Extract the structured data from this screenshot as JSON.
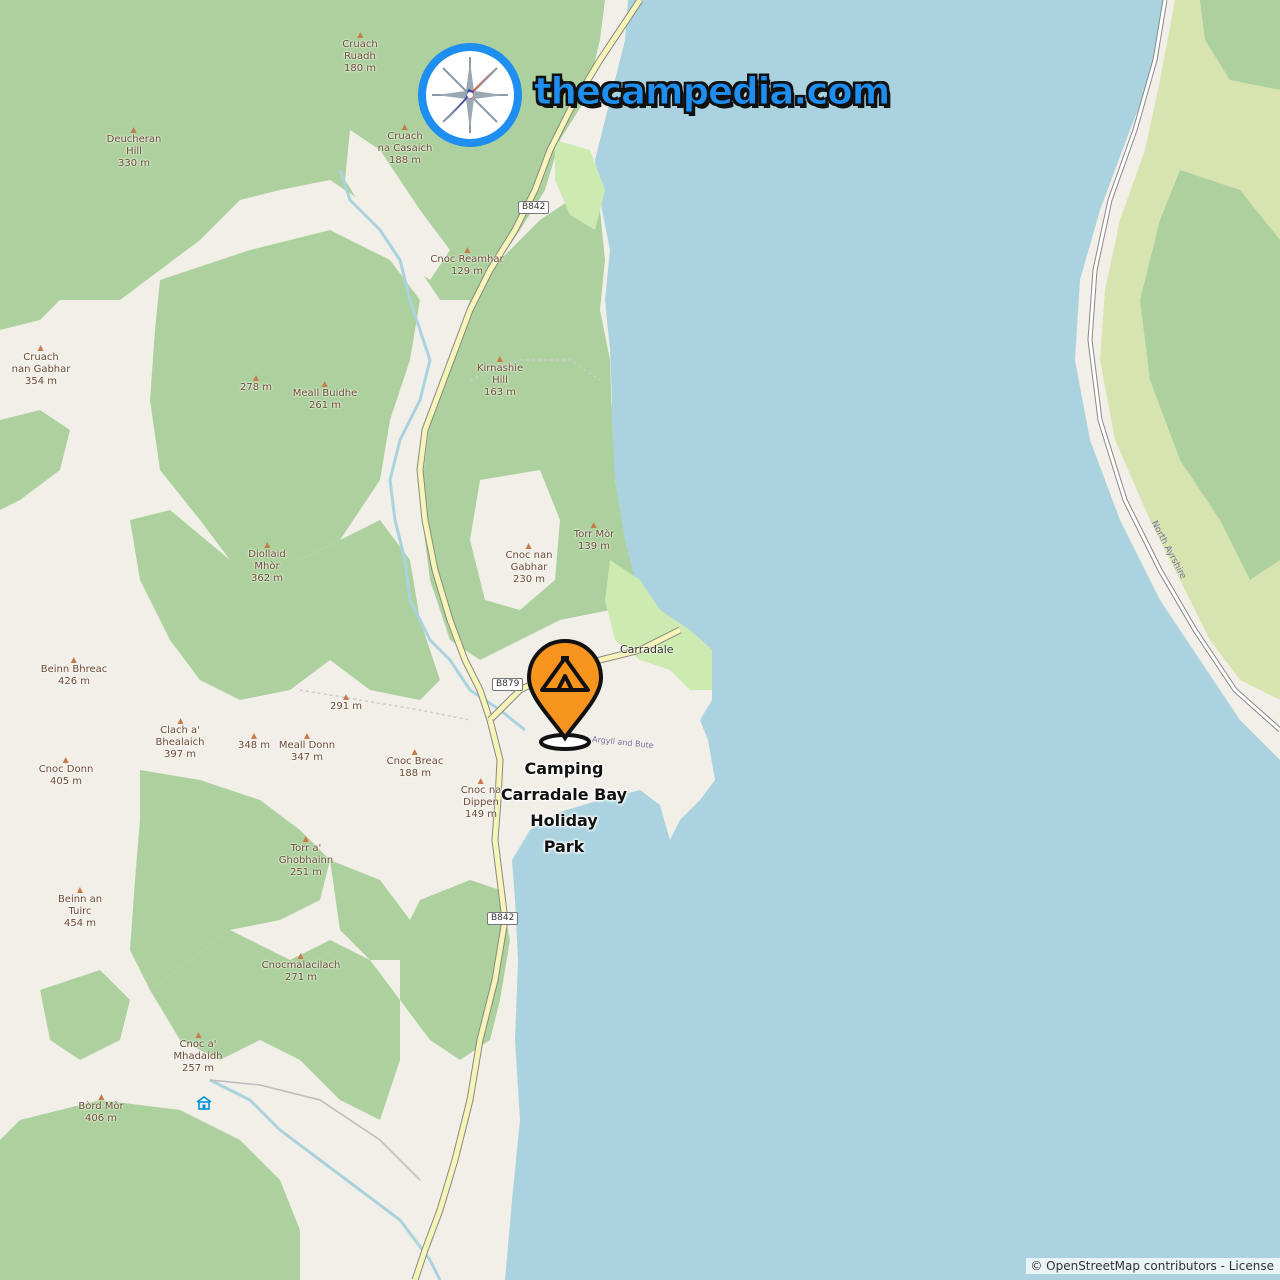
{
  "brand": {
    "name": "thecampedia.com",
    "logo_icon": "compass-icon"
  },
  "campsite": {
    "label_lines": [
      "Camping",
      "Carradale Bay",
      "Holiday",
      "Park"
    ],
    "marker_icon": "tent-icon"
  },
  "places": {
    "carradale": "Carradale",
    "bay": "Argyll and Bute",
    "shore": "North Ayrshire"
  },
  "roads": {
    "b842_north": "B842",
    "b879": "B879",
    "b842_south": "B842"
  },
  "peaks": [
    {
      "lines": [
        "Cruach",
        "Ruadh",
        "180 m"
      ]
    },
    {
      "lines": [
        "Deucheran",
        "Hill",
        "330 m"
      ]
    },
    {
      "lines": [
        "Cruach",
        "na Casaich",
        "188 m"
      ]
    },
    {
      "lines": [
        "Cnoc Reamhar",
        "129 m"
      ]
    },
    {
      "lines": [
        "Cruach",
        "nan Gabhar",
        "354 m"
      ]
    },
    {
      "lines": [
        "278 m"
      ]
    },
    {
      "lines": [
        "Meall Buidhe",
        "261 m"
      ]
    },
    {
      "lines": [
        "Kirnashie",
        "Hill",
        "163 m"
      ]
    },
    {
      "lines": [
        "Torr Mòr",
        "139 m"
      ]
    },
    {
      "lines": [
        "Diollaid",
        "Mhòr",
        "362 m"
      ]
    },
    {
      "lines": [
        "Cnoc nan",
        "Gabhar",
        "230 m"
      ]
    },
    {
      "lines": [
        "Beinn Bhreac",
        "426 m"
      ]
    },
    {
      "lines": [
        "291 m"
      ]
    },
    {
      "lines": [
        "Clach a'",
        "Bhealaich",
        "397 m"
      ]
    },
    {
      "lines": [
        "348 m"
      ]
    },
    {
      "lines": [
        "Meall Donn",
        "347 m"
      ]
    },
    {
      "lines": [
        "Cnoc Breac",
        "188 m"
      ]
    },
    {
      "lines": [
        "Cnoc Donn",
        "405 m"
      ]
    },
    {
      "lines": [
        "Cnoc na",
        "Dippen",
        "149 m"
      ]
    },
    {
      "lines": [
        "Torr a'",
        "Ghobhainn",
        "251 m"
      ]
    },
    {
      "lines": [
        "Beinn an",
        "Tuirc",
        "454 m"
      ]
    },
    {
      "lines": [
        "Cnocmalacilach",
        "271 m"
      ]
    },
    {
      "lines": [
        "Cnoc a'",
        "Mhadaidh",
        "257 m"
      ]
    },
    {
      "lines": [
        "Bòrd Mòr",
        "406 m"
      ]
    }
  ],
  "attribution": {
    "copyright": "© OpenStreetMap contributors",
    "separator": " - ",
    "license": "License"
  },
  "colors": {
    "water": "#aad3df",
    "land": "#f2efe9",
    "forest": "#add19e",
    "farmland": "#d8e4b0",
    "road_yellow": "#f7f4b8",
    "marker_orange": "#f7941d",
    "brand_blue": "#1e8ef0"
  }
}
